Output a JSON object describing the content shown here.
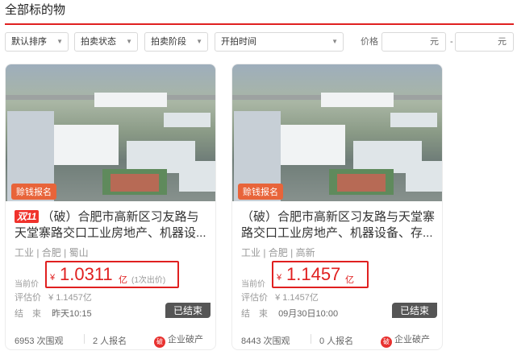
{
  "section": {
    "title": "全部标的物"
  },
  "filters": {
    "sort": "默认排序",
    "status": "拍卖状态",
    "stage": "拍卖阶段",
    "start_time": "开拍时间",
    "price_label": "价格",
    "min_placeholder": "元",
    "dash": "-",
    "max_placeholder": "元"
  },
  "cards": [
    {
      "tag": "赊钱报名",
      "promo": "双11",
      "title": "（破）合肥市高新区习友路与天堂寨路交口工业房地产、机器设...",
      "tags": "工业 | 合肥 | 蜀山",
      "price_label": "当前价",
      "currency": "¥",
      "price": "1.0311",
      "unit": "亿",
      "bids": "(1次出价)",
      "est_label": "评估价",
      "est_value": "¥ 1.1457亿",
      "end_label": "结　束",
      "end_time": "昨天10:15",
      "status": "已结束",
      "views": "6953 次围观",
      "signups": "2 人报名",
      "category_icon": "破",
      "category": "企业破产"
    },
    {
      "tag": "赊钱报名",
      "promo": "",
      "title": "（破）合肥市高新区习友路与天堂寨路交口工业房地产、机器设备、存...",
      "tags": "工业 | 合肥 | 高新",
      "price_label": "当前价",
      "currency": "¥",
      "price": "1.1457",
      "unit": "亿",
      "bids": "",
      "est_label": "评估价",
      "est_value": "¥ 1.1457亿",
      "end_label": "结　束",
      "end_time": "09月30日10:00",
      "status": "已结束",
      "views": "8443 次围观",
      "signups": "0 人报名",
      "category_icon": "破",
      "category": "企业破产"
    }
  ]
}
